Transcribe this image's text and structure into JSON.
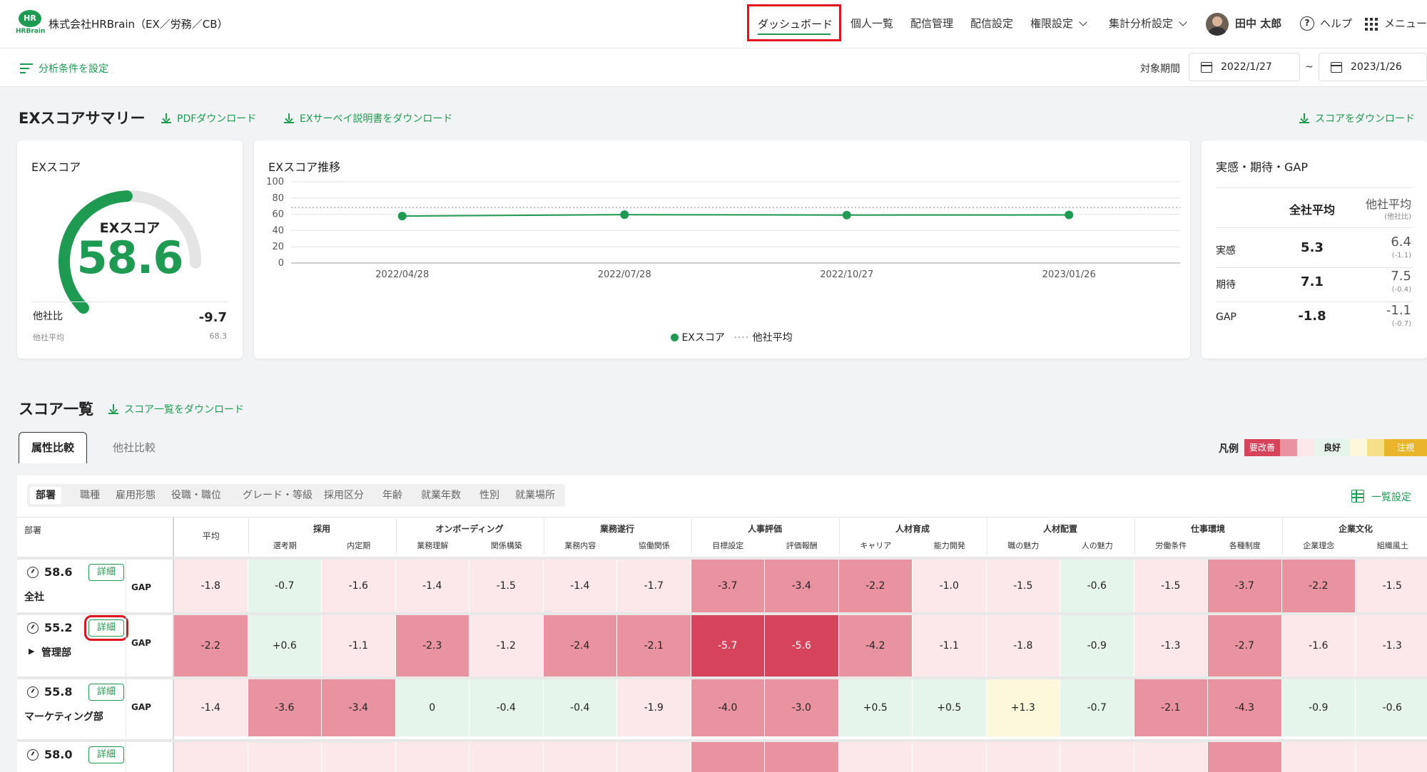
{
  "header": {
    "logo_text": "HR",
    "logo_sub": "HRBrain",
    "company": "株式会社HRBrain（EX／労務／CB）",
    "nav": [
      "ダッシュボード",
      "個人一覧",
      "配信管理",
      "配信設定",
      "権限設定",
      "集計分析設定"
    ],
    "user_name": "田中 太郎",
    "help": "ヘルプ",
    "help_icon_char": "?",
    "menu": "メニュー"
  },
  "subbar": {
    "filter_label": "分析条件を設定",
    "period_label": "対象期間",
    "date_from": "2022/1/27",
    "date_sep": "~",
    "date_to": "2023/1/26"
  },
  "summary": {
    "title": "EXスコアサマリー",
    "pdf_download": "PDFダウンロード",
    "guide_download": "EXサーベイ説明書をダウンロード",
    "score_download": "スコアをダウンロード"
  },
  "ex_card": {
    "title": "EXスコア",
    "gauge_label": "EXスコア",
    "score": "58.6",
    "score_value": 58.6,
    "compare_label": "他社比",
    "compare_value": "-9.7",
    "avg_label": "他社平均",
    "avg_value": "68.3",
    "accent": "#1f9a53"
  },
  "trend_card": {
    "title": "EXスコア推移",
    "legend_ex": "EXスコア",
    "legend_dots": "····",
    "legend_avg": "他社平均"
  },
  "chart_data": {
    "type": "line",
    "x": [
      "2022/04/28",
      "2022/07/28",
      "2022/10/27",
      "2023/01/26"
    ],
    "series": [
      {
        "name": "EXスコア",
        "values": [
          57.8,
          59.5,
          59.0,
          59.2
        ]
      }
    ],
    "reference": {
      "name": "他社平均",
      "value": 68.3
    },
    "yticks": [
      0,
      20,
      40,
      60,
      80,
      100
    ],
    "ylim": [
      0,
      100
    ],
    "grid": true,
    "legend": "bottom"
  },
  "gap_card": {
    "title": "実感・期待・GAP",
    "col_all": "全社平均",
    "col_other": "他社平均",
    "col_other_sub": "(他社比)",
    "rows": [
      {
        "label": "実感",
        "all": "5.3",
        "other": "6.4",
        "diff": "(-1.1)"
      },
      {
        "label": "期待",
        "all": "7.1",
        "other": "7.5",
        "diff": "(-0.4)"
      },
      {
        "label": "GAP",
        "all": "-1.8",
        "other": "-1.1",
        "diff": "(-0.7)"
      }
    ]
  },
  "score_list": {
    "title": "スコア一覧",
    "download": "スコア一覧をダウンロード",
    "tab_attr": "属性比較",
    "tab_other": "他社比較",
    "legend_label": "凡例",
    "legend_bad": "要改善",
    "legend_good": "良好",
    "legend_warn": "注視",
    "filters": [
      "部署",
      "職種",
      "雇用形態",
      "役職・職位",
      "グレード・等級",
      "採用区分",
      "年齢",
      "就業年数",
      "性別",
      "就業場所"
    ],
    "list_settings": "一覧設定",
    "dept_header": "部署",
    "avg_header": "平均",
    "groups": [
      {
        "name": "採用",
        "subs": [
          "選考期",
          "内定期"
        ]
      },
      {
        "name": "オンボーディング",
        "subs": [
          "業務理解",
          "関係構築"
        ]
      },
      {
        "name": "業務遂行",
        "subs": [
          "業務内容",
          "協働関係"
        ]
      },
      {
        "name": "人事評価",
        "subs": [
          "目標設定",
          "評価報酬"
        ]
      },
      {
        "name": "人材育成",
        "subs": [
          "キャリア",
          "能力開発"
        ]
      },
      {
        "name": "人材配置",
        "subs": [
          "職の魅力",
          "人の魅力"
        ]
      },
      {
        "name": "仕事環境",
        "subs": [
          "労働条件",
          "各種制度"
        ]
      },
      {
        "name": "企業文化",
        "subs": [
          "企業理念",
          "組織風土"
        ]
      }
    ],
    "rows": [
      {
        "score": "58.6",
        "name": "全社",
        "detail": "詳細",
        "gap": "GAP",
        "expand": "",
        "avg": "-1.8",
        "values": [
          "-0.7",
          "-1.6",
          "-1.4",
          "-1.5",
          "-1.4",
          "-1.7",
          "-3.7",
          "-3.4",
          "-2.2",
          "-1.0",
          "-1.5",
          "-0.6",
          "-1.5",
          "-3.7",
          "-2.2",
          "-1.5"
        ]
      },
      {
        "score": "55.2",
        "name": "管理部",
        "detail": "詳細",
        "gap": "GAP",
        "expand": "▶",
        "avg": "-2.2",
        "values": [
          "+0.6",
          "-1.1",
          "-2.3",
          "-1.2",
          "-2.4",
          "-2.1",
          "-5.7",
          "-5.6",
          "-4.2",
          "-1.1",
          "-1.8",
          "-0.9",
          "-1.3",
          "-2.7",
          "-1.6",
          "-1.3"
        ]
      },
      {
        "score": "55.8",
        "name": "マーケティング部",
        "detail": "詳細",
        "gap": "GAP",
        "expand": "",
        "avg": "-1.4",
        "values": [
          "-3.6",
          "-3.4",
          "0",
          "-0.4",
          "-0.4",
          "-1.9",
          "-4.0",
          "-3.0",
          "+0.5",
          "+0.5",
          "+1.3",
          "-0.7",
          "-2.1",
          "-4.3",
          "-0.9",
          "-0.6"
        ]
      },
      {
        "score": "58.0",
        "name": "",
        "detail": "詳細",
        "gap": "",
        "expand": "",
        "avg": "",
        "values": [
          "",
          "",
          "",
          "",
          "",
          "",
          "",
          "",
          "",
          "",
          "",
          "",
          "",
          "",
          "",
          ""
        ]
      }
    ],
    "fill_colors": [
      "#e6f5ec",
      "#fce8ea",
      "#ea93a0",
      "#d6445c"
    ],
    "bg_fill_row4": [
      "#fce8ea",
      "#fce8ea",
      "#fce8ea",
      "#fce8ea",
      "#fce8ea",
      "#fce8ea",
      "#fce8ea",
      "#ea93a0",
      "#ea93a0",
      "#fce8ea",
      "#fce8ea",
      "#fce8ea",
      "#fce8ea",
      "#fce8ea",
      "#ea93a0",
      "#fce8ea",
      "#fce8ea"
    ],
    "highlight_color": "#e0141e"
  }
}
